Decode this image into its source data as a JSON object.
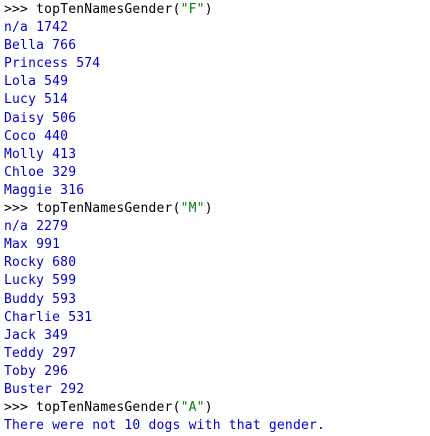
{
  "shell": {
    "prompt": ">>> ",
    "colors": {
      "prompt": "#000000",
      "string": "#008000",
      "output": "#0000cc"
    },
    "blocks": [
      {
        "call_pre": "topTenNamesGender(",
        "arg": "\"F\"",
        "call_post": ")",
        "output": [
          "n/a 1742",
          "Bella 766",
          "Princess 574",
          "Lola 549",
          "Lucy 514",
          "Daisy 506",
          "Coco 440",
          "Molly 413",
          "Chloe 329",
          "Maggie 316"
        ]
      },
      {
        "call_pre": "topTenNamesGender(",
        "arg": "\"M\"",
        "call_post": ")",
        "output": [
          "n/a 2279",
          "Max 991",
          "Rocky 680",
          "Lucky 599",
          "Buddy 593",
          "Charlie 531",
          "Jack 349",
          "Teddy 297",
          "Toby 296",
          "Buster 292"
        ]
      },
      {
        "call_pre": "topTenNamesGender(",
        "arg": "\"A\"",
        "call_post": ")",
        "output": [
          "There were not 10 dogs with that gender."
        ]
      }
    ]
  }
}
